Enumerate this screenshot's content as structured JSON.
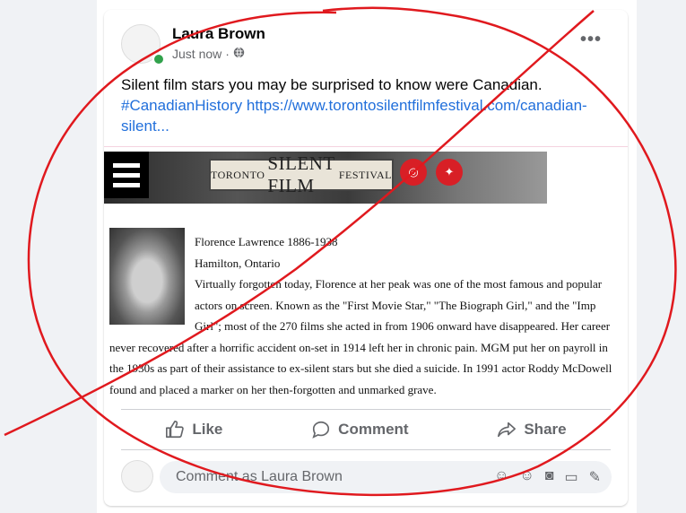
{
  "post": {
    "author": "Laura Brown",
    "timestamp": "Just now",
    "privacy_icon": "globe-icon",
    "more_label": "•••",
    "text": "Silent film stars you may be surprised to know were Canadian.",
    "hashtag": "#CanadianHistory",
    "link": "https://www.torontosilentfilmfestival.com/canadian-silent..."
  },
  "banner": {
    "left": "TORONTO",
    "big": "SILENT FILM",
    "right": "FESTIVAL",
    "instagram_icon": "instagram-icon",
    "twitter_icon": "twitter-icon"
  },
  "bio": {
    "name": "Florence Lawrence 1886-1938",
    "place": "Hamilton, Ontario",
    "line1": "Virtually forgotten today, Florence at her peak was one of the most famous and popular",
    "line2": "actors on screen. Known as the \"First Movie Star,\" \"The Biograph Girl,\" and the \"Imp",
    "line3": "Girl\"; most of the 270 films she acted in from 1906 onward have disappeared. Her career",
    "line4": "never recovered after a horrific accident on-set in 1914 left her in chronic pain. MGM put her on payroll in",
    "line5": "the 1930s as part of their assistance to ex-silent stars but she died a suicide. In 1991 actor Roddy McDowell",
    "line6": "found and placed a marker on her then-forgotten and unmarked grave."
  },
  "actions": {
    "like": "Like",
    "comment": "Comment",
    "share": "Share"
  },
  "comment_box": {
    "placeholder": "Comment as Laura Brown"
  },
  "colors": {
    "link": "#216fdb",
    "annotation": "#e0191e"
  }
}
